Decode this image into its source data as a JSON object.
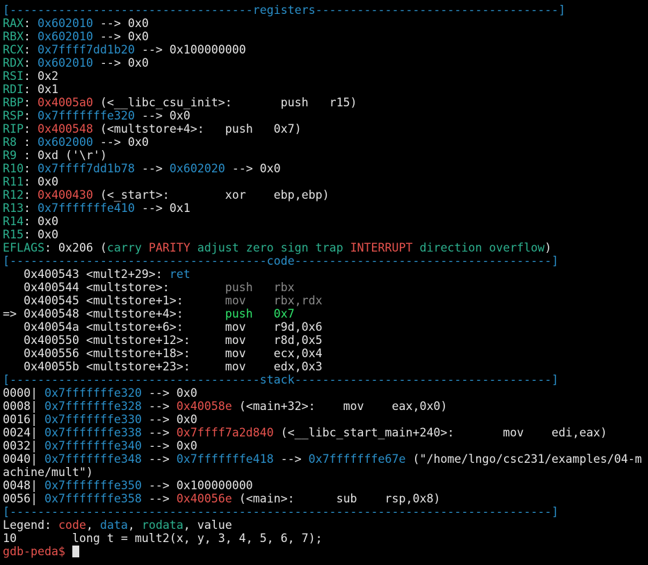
{
  "colors": {
    "default": "#e5e5e5",
    "green": "#2cb08e",
    "blue": "#2a8fc9",
    "red": "#e8534e",
    "gray": "#8a8a8a",
    "bright_green": "#2fe36a",
    "prompt_red": "#e8534e",
    "cursor": "#e0e0e0"
  },
  "terminal": {
    "lines": [
      [
        [
          "blue",
          "[-----------------------------------registers-----------------------------------]"
        ]
      ],
      [
        [
          "green",
          "RAX"
        ],
        [
          "default",
          ": "
        ],
        [
          "blue",
          "0x602010"
        ],
        [
          "default",
          " --> 0x0"
        ]
      ],
      [
        [
          "green",
          "RBX"
        ],
        [
          "default",
          ": "
        ],
        [
          "blue",
          "0x602010"
        ],
        [
          "default",
          " --> 0x0"
        ]
      ],
      [
        [
          "green",
          "RCX"
        ],
        [
          "default",
          ": "
        ],
        [
          "blue",
          "0x7ffff7dd1b20"
        ],
        [
          "default",
          " --> 0x100000000"
        ]
      ],
      [
        [
          "green",
          "RDX"
        ],
        [
          "default",
          ": "
        ],
        [
          "blue",
          "0x602010"
        ],
        [
          "default",
          " --> 0x0"
        ]
      ],
      [
        [
          "green",
          "RSI"
        ],
        [
          "default",
          ": 0x2"
        ]
      ],
      [
        [
          "green",
          "RDI"
        ],
        [
          "default",
          ": 0x1"
        ]
      ],
      [
        [
          "green",
          "RBP"
        ],
        [
          "default",
          ": "
        ],
        [
          "red",
          "0x4005a0"
        ],
        [
          "default",
          " (<__libc_csu_init>:       push   r15)"
        ]
      ],
      [
        [
          "green",
          "RSP"
        ],
        [
          "default",
          ": "
        ],
        [
          "blue",
          "0x7fffffffe320"
        ],
        [
          "default",
          " --> 0x0"
        ]
      ],
      [
        [
          "green",
          "RIP"
        ],
        [
          "default",
          ": "
        ],
        [
          "red",
          "0x400548"
        ],
        [
          "default",
          " (<multstore+4>:   push   0x7)"
        ]
      ],
      [
        [
          "green",
          "R8 "
        ],
        [
          "default",
          ": "
        ],
        [
          "blue",
          "0x602000"
        ],
        [
          "default",
          " --> 0x0"
        ]
      ],
      [
        [
          "green",
          "R9 "
        ],
        [
          "default",
          ": 0xd ('\\r')"
        ]
      ],
      [
        [
          "green",
          "R10"
        ],
        [
          "default",
          ": "
        ],
        [
          "blue",
          "0x7ffff7dd1b78"
        ],
        [
          "default",
          " --> "
        ],
        [
          "blue",
          "0x602020"
        ],
        [
          "default",
          " --> 0x0"
        ]
      ],
      [
        [
          "green",
          "R11"
        ],
        [
          "default",
          ": 0x0"
        ]
      ],
      [
        [
          "green",
          "R12"
        ],
        [
          "default",
          ": "
        ],
        [
          "red",
          "0x400430"
        ],
        [
          "default",
          " (<_start>:        xor    ebp,ebp)"
        ]
      ],
      [
        [
          "green",
          "R13"
        ],
        [
          "default",
          ": "
        ],
        [
          "blue",
          "0x7fffffffe410"
        ],
        [
          "default",
          " --> 0x1"
        ]
      ],
      [
        [
          "green",
          "R14"
        ],
        [
          "default",
          ": 0x0"
        ]
      ],
      [
        [
          "green",
          "R15"
        ],
        [
          "default",
          ": 0x0"
        ]
      ],
      [
        [
          "green",
          "EFLAGS"
        ],
        [
          "default",
          ": 0x206 ("
        ],
        [
          "green",
          "carry "
        ],
        [
          "red",
          "PARITY "
        ],
        [
          "green",
          "adjust zero sign trap "
        ],
        [
          "red",
          "INTERRUPT "
        ],
        [
          "green",
          "direction overflow"
        ],
        [
          "default",
          ")"
        ]
      ],
      [
        [
          "blue",
          "[-------------------------------------code-------------------------------------]"
        ]
      ],
      [
        [
          "default",
          "   0x400543 <mult2+29>: "
        ],
        [
          "blue",
          "ret"
        ]
      ],
      [
        [
          "default",
          "   0x400544 <multstore>:        "
        ],
        [
          "gray",
          "push   rbx"
        ]
      ],
      [
        [
          "default",
          "   0x400545 <multstore+1>:      "
        ],
        [
          "gray",
          "mov    rbx,rdx"
        ]
      ],
      [
        [
          "default",
          "=> 0x400548 <multstore+4>:      "
        ],
        [
          "bright_green",
          "push   0x7"
        ]
      ],
      [
        [
          "default",
          "   0x40054a <multstore+6>:      mov    r9d,0x6"
        ]
      ],
      [
        [
          "default",
          "   0x400550 <multstore+12>:     mov    r8d,0x5"
        ]
      ],
      [
        [
          "default",
          "   0x400556 <multstore+18>:     mov    ecx,0x4"
        ]
      ],
      [
        [
          "default",
          "   0x40055b <multstore+23>:     mov    edx,0x3"
        ]
      ],
      [
        [
          "blue",
          "[------------------------------------stack-------------------------------------]"
        ]
      ],
      [
        [
          "default",
          "0000| "
        ],
        [
          "blue",
          "0x7fffffffe320"
        ],
        [
          "default",
          " --> 0x0"
        ]
      ],
      [
        [
          "default",
          "0008| "
        ],
        [
          "blue",
          "0x7fffffffe328"
        ],
        [
          "default",
          " --> "
        ],
        [
          "red",
          "0x40058e"
        ],
        [
          "default",
          " (<main+32>:    mov    eax,0x0)"
        ]
      ],
      [
        [
          "default",
          "0016| "
        ],
        [
          "blue",
          "0x7fffffffe330"
        ],
        [
          "default",
          " --> 0x0"
        ]
      ],
      [
        [
          "default",
          "0024| "
        ],
        [
          "blue",
          "0x7fffffffe338"
        ],
        [
          "default",
          " --> "
        ],
        [
          "red",
          "0x7ffff7a2d840"
        ],
        [
          "default",
          " (<__libc_start_main+240>:       mov    edi,eax)"
        ]
      ],
      [
        [
          "default",
          "0032| "
        ],
        [
          "blue",
          "0x7fffffffe340"
        ],
        [
          "default",
          " --> 0x0"
        ]
      ],
      [
        [
          "default",
          "0040| "
        ],
        [
          "blue",
          "0x7fffffffe348"
        ],
        [
          "default",
          " --> "
        ],
        [
          "blue",
          "0x7fffffffe418"
        ],
        [
          "default",
          " --> "
        ],
        [
          "blue",
          "0x7fffffffe67e"
        ],
        [
          "default",
          " (\"/home/lngo/csc231/examples/04-m"
        ]
      ],
      [
        [
          "default",
          "achine/mult\")"
        ]
      ],
      [
        [
          "default",
          "0048| "
        ],
        [
          "blue",
          "0x7fffffffe350"
        ],
        [
          "default",
          " --> 0x100000000"
        ]
      ],
      [
        [
          "default",
          "0056| "
        ],
        [
          "blue",
          "0x7fffffffe358"
        ],
        [
          "default",
          " --> "
        ],
        [
          "red",
          "0x40056e"
        ],
        [
          "default",
          " (<main>:      sub    rsp,0x8)"
        ]
      ],
      [
        [
          "blue",
          "[------------------------------------------------------------------------------]"
        ]
      ],
      [
        [
          "default",
          "Legend: "
        ],
        [
          "red",
          "code"
        ],
        [
          "default",
          ", "
        ],
        [
          "blue",
          "data"
        ],
        [
          "default",
          ", "
        ],
        [
          "green",
          "rodata"
        ],
        [
          "default",
          ", value"
        ]
      ],
      [
        [
          "default",
          "10        long t = mult2(x, y, 3, 4, 5, 6, 7);"
        ]
      ]
    ],
    "prompt": "gdb-peda$ "
  }
}
